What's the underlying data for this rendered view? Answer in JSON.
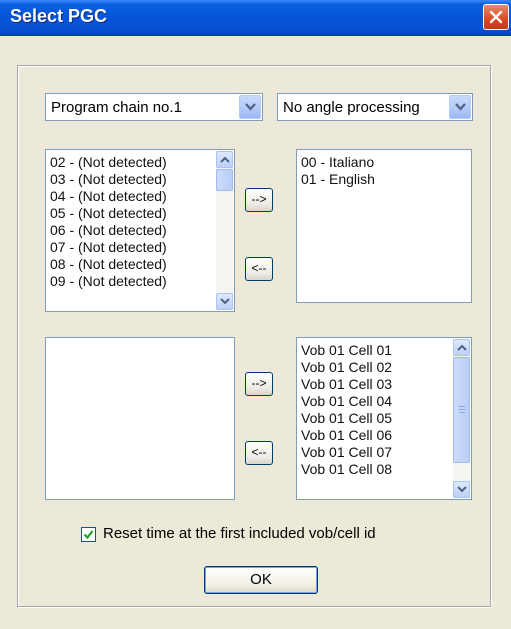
{
  "window": {
    "title": "Select PGC"
  },
  "program_chain": {
    "selected": "Program chain no.1"
  },
  "angle": {
    "selected": "No angle processing"
  },
  "audio_available": {
    "items": [
      "02 - (Not detected)",
      "03 - (Not detected)",
      "04 - (Not detected)",
      "05 - (Not detected)",
      "06 - (Not detected)",
      "07 - (Not detected)",
      "08 - (Not detected)",
      "09 - (Not detected)"
    ]
  },
  "audio_selected": {
    "items": [
      "00 - Italiano",
      "01 - English"
    ]
  },
  "cells_selected": {
    "items": [
      "Vob 01 Cell 01",
      "Vob 01 Cell 02",
      "Vob 01 Cell 03",
      "Vob 01 Cell 04",
      "Vob 01 Cell 05",
      "Vob 01 Cell 06",
      "Vob 01 Cell 07",
      "Vob 01 Cell 08"
    ]
  },
  "buttons": {
    "add": "-->",
    "remove": "<--",
    "ok": "OK"
  },
  "reset_time": {
    "label": "Reset time at the first included vob/cell id",
    "checked": true
  },
  "icons": {
    "close": "close-icon",
    "dropdown": "chevron-down-icon",
    "scroll_up": "scroll-up-icon",
    "scroll_down": "scroll-down-icon",
    "check": "checkmark-icon"
  },
  "colors": {
    "title_bar": "#0454d9",
    "dialog": "#ece9d8",
    "close_button": "#d84a23"
  }
}
